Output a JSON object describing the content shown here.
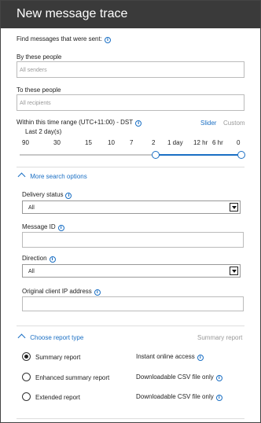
{
  "header": {
    "title": "New message trace"
  },
  "intro": {
    "label": "Find messages that were sent:"
  },
  "senders": {
    "label": "By these people",
    "placeholder": "All senders"
  },
  "recipients": {
    "label": "To these people",
    "placeholder": "All recipients"
  },
  "time_range": {
    "label": "Within this time range (UTC+11:00) - DST",
    "mode_slider": "Slider",
    "mode_custom": "Custom",
    "summary": "Last 2 day(s)",
    "ticks": [
      "90",
      "30",
      "15",
      "10",
      "7",
      "2",
      "1 day",
      "12 hr",
      "6 hr",
      "0"
    ]
  },
  "more_options": {
    "label": "More search options"
  },
  "delivery_status": {
    "label": "Delivery status",
    "value": "All"
  },
  "message_id": {
    "label": "Message ID",
    "value": ""
  },
  "direction": {
    "label": "Direction",
    "value": "All"
  },
  "client_ip": {
    "label": "Original client IP address",
    "value": ""
  },
  "report_type": {
    "label": "Choose report type",
    "current": "Summary report",
    "options": [
      {
        "name": "Summary report",
        "desc": "Instant online access",
        "selected": true
      },
      {
        "name": "Enhanced summary report",
        "desc": "Downloadable CSV file only",
        "selected": false
      },
      {
        "name": "Extended report",
        "desc": "Downloadable CSV file only",
        "selected": false
      }
    ]
  },
  "colors": {
    "accent": "#1a6fc4",
    "header_bg": "#3a3a3a"
  }
}
